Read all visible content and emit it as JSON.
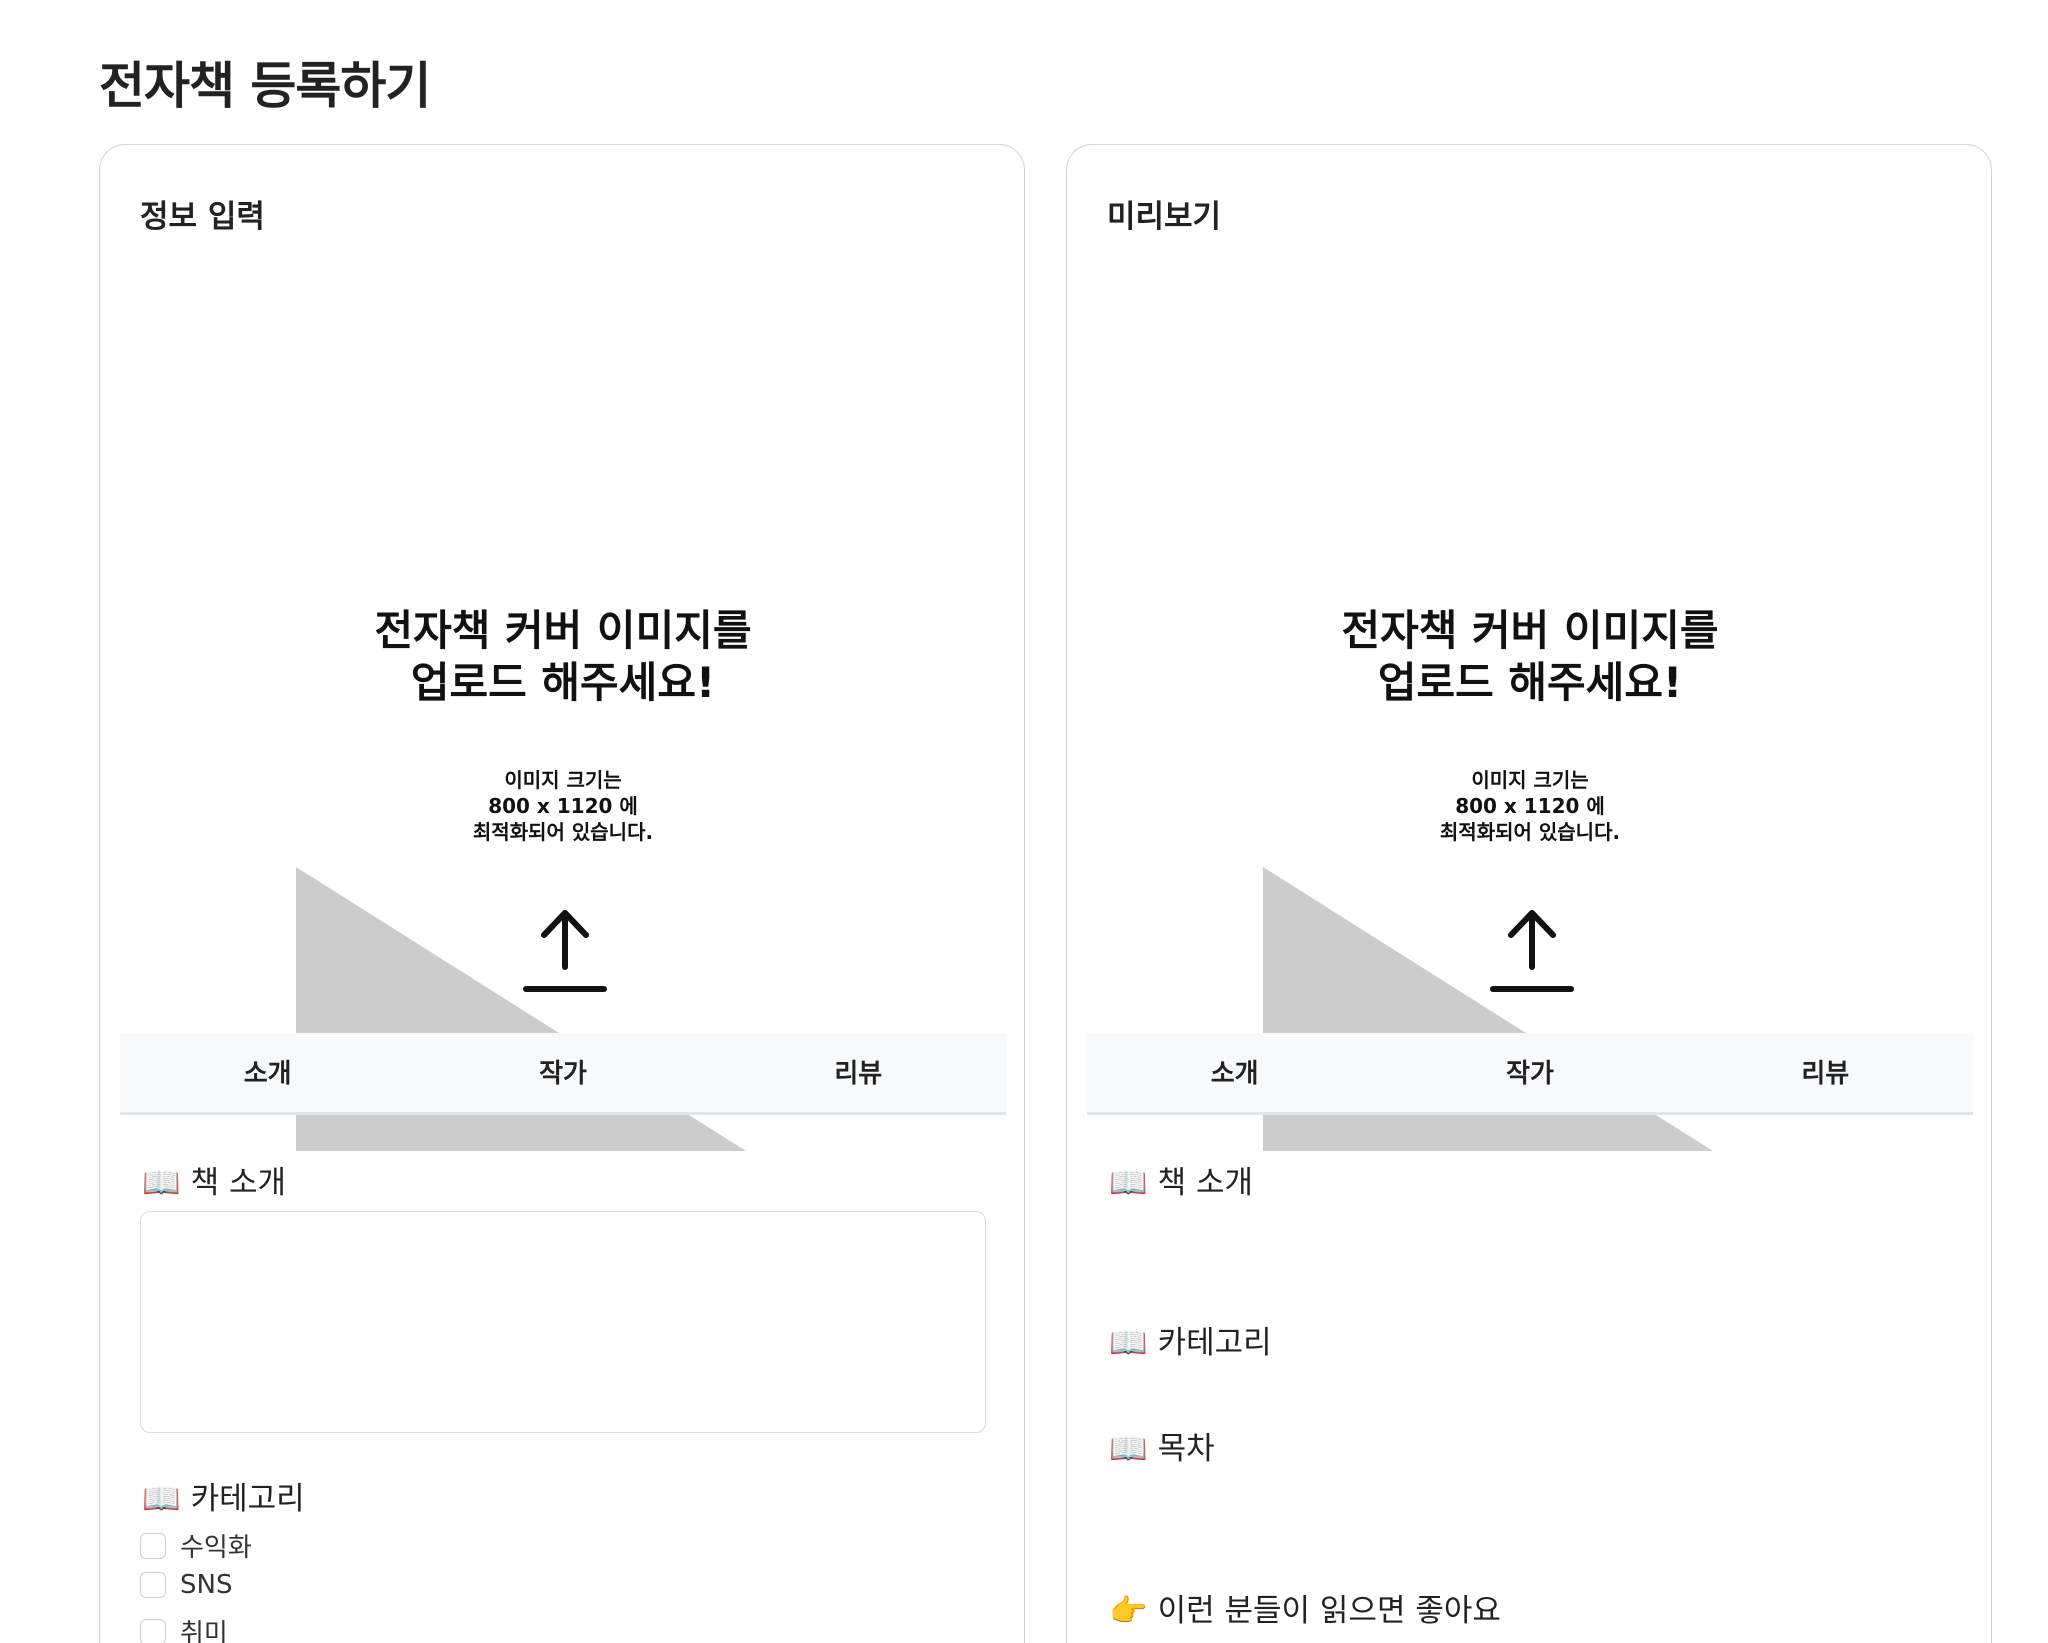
{
  "page": {
    "title": "전자책 등록하기"
  },
  "left_panel": {
    "title": "정보 입력",
    "upload": {
      "heading_line1": "전자책 커버 이미지를",
      "heading_line2": "업로드 해주세요!",
      "sub_line1": "이미지 크기는",
      "sub_line2": "800 x 1120 에",
      "sub_line3": "최적화되어 있습니다."
    },
    "tabs": [
      {
        "label": "소개"
      },
      {
        "label": "작가"
      },
      {
        "label": "리뷰"
      }
    ],
    "sections": {
      "intro": {
        "emoji": "📖",
        "label": "책 소개",
        "value": ""
      },
      "category": {
        "emoji": "📖",
        "label": "카테고리"
      }
    },
    "categories": [
      {
        "label": "수익화",
        "checked": false
      },
      {
        "label": "SNS",
        "checked": false
      },
      {
        "label": "취미",
        "checked": false
      }
    ]
  },
  "right_panel": {
    "title": "미리보기",
    "upload": {
      "heading_line1": "전자책 커버 이미지를",
      "heading_line2": "업로드 해주세요!",
      "sub_line1": "이미지 크기는",
      "sub_line2": "800 x 1120 에",
      "sub_line3": "최적화되어 있습니다."
    },
    "tabs": [
      {
        "label": "소개"
      },
      {
        "label": "작가"
      },
      {
        "label": "리뷰"
      }
    ],
    "sections": {
      "intro": {
        "emoji": "📖",
        "label": "책 소개"
      },
      "category": {
        "emoji": "📖",
        "label": "카테고리"
      },
      "toc": {
        "emoji": "📖",
        "label": "목차"
      },
      "audience": {
        "emoji": "👉",
        "label": "이런 분들이 읽으면 좋아요"
      }
    }
  },
  "icons": {
    "upload": "upload-arrow-icon",
    "placeholder": "image-placeholder-triangle"
  },
  "colors": {
    "placeholder_gray": "#cccccc",
    "tab_bar_bg": "#f8f9fb",
    "border": "#d4d4d4"
  }
}
